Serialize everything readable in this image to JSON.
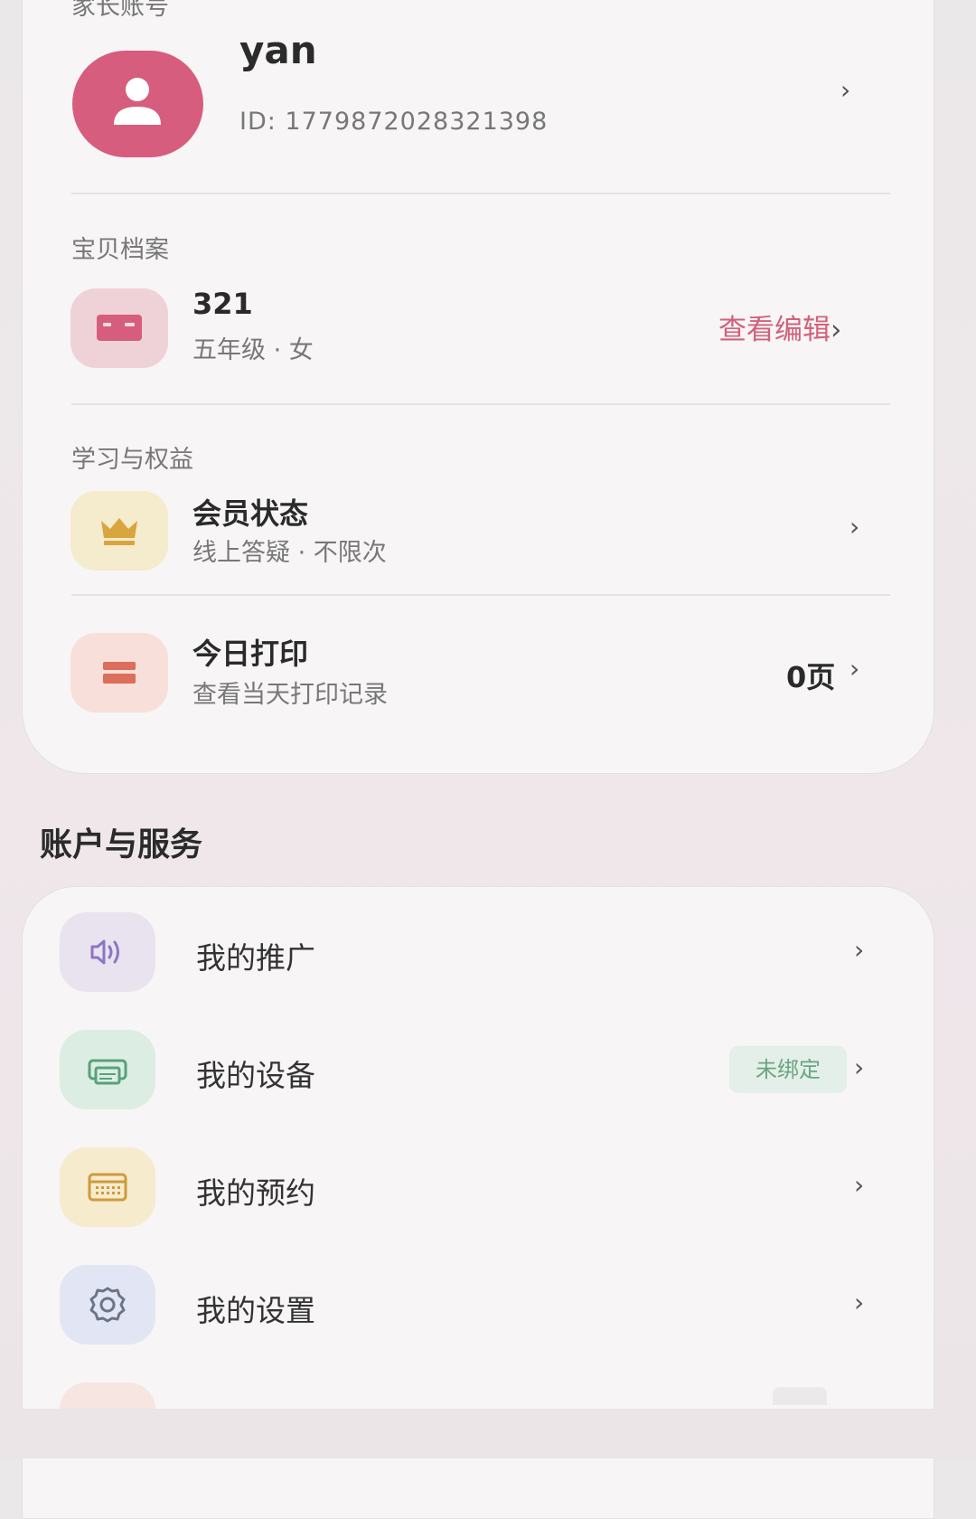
{
  "colors": {
    "accent": "#d65d7d",
    "edit_link": "#d2617c",
    "badge_text": "#6aa583"
  },
  "parent_account": {
    "section_label": "家长账号",
    "name": "yan",
    "id_text": "ID: 1779872028321398",
    "icon": "user-icon"
  },
  "child_profile": {
    "section_label": "宝贝档案",
    "name": "321",
    "details": "五年级 · 女",
    "action_label": "查看编辑",
    "icon": "id-card-icon"
  },
  "learning": {
    "section_label": "学习与权益",
    "membership": {
      "title": "会员状态",
      "subtitle": "线上答疑 · 不限次",
      "icon": "crown-icon"
    },
    "print_today": {
      "title": "今日打印",
      "subtitle": "查看当天打印记录",
      "value": "0页",
      "icon": "printer-icon"
    }
  },
  "services": {
    "heading": "账户与服务",
    "items": [
      {
        "label": "我的推广",
        "icon": "speaker-icon"
      },
      {
        "label": "我的设备",
        "icon": "device-icon",
        "badge": "未绑定"
      },
      {
        "label": "我的预约",
        "icon": "calendar-icon"
      },
      {
        "label": "我的设置",
        "icon": "gear-icon"
      }
    ]
  }
}
